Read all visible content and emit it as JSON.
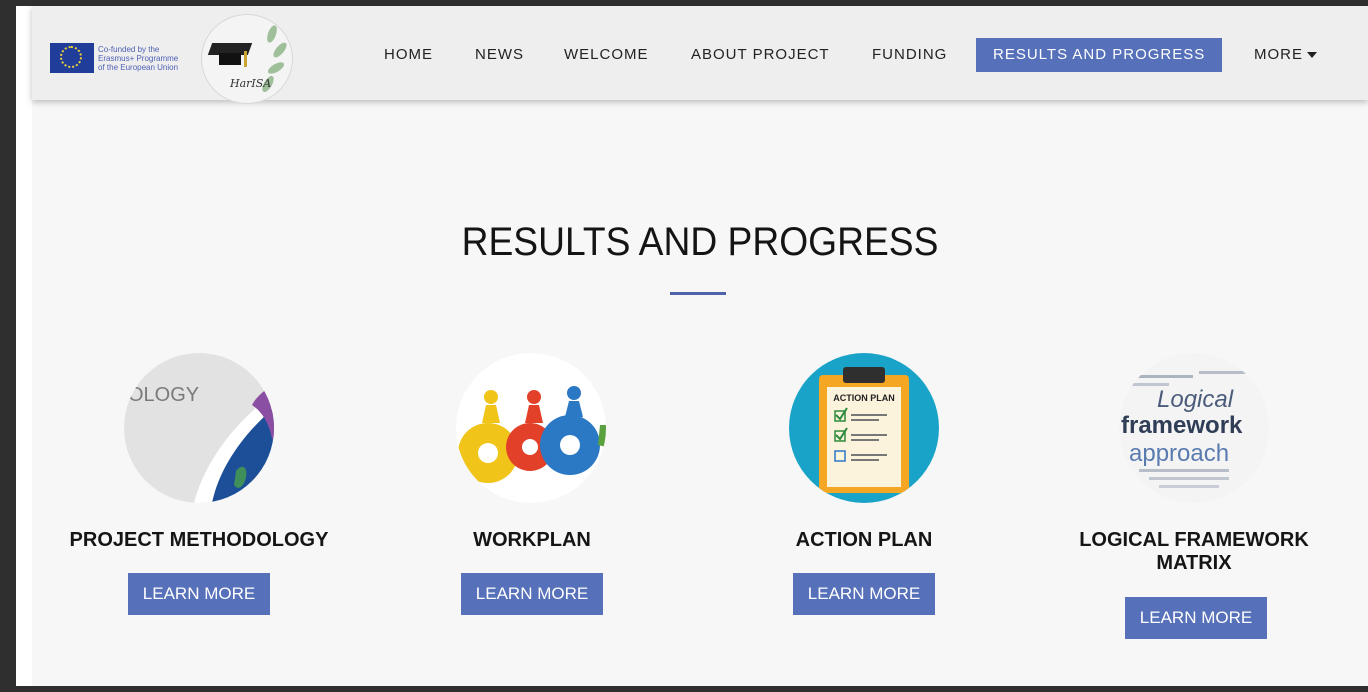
{
  "header": {
    "eu_text": [
      "Co-funded by the",
      "Erasmus+ Programme",
      "of the European Union"
    ],
    "logo_text": "HarISA"
  },
  "nav": {
    "home": "HOME",
    "news": "NEWS",
    "welcome": "WELCOME",
    "about": "ABOUT PROJECT",
    "funding": "FUNDING",
    "results": "RESULTS AND PROGRESS",
    "more": "MORE"
  },
  "main": {
    "title": "RESULTS AND PROGRESS",
    "cards": [
      {
        "title": "PROJECT METHODOLOGY",
        "image_text": "OLOGY",
        "button": "LEARN MORE"
      },
      {
        "title": "WORKPLAN",
        "button": "LEARN MORE"
      },
      {
        "title": "ACTION PLAN",
        "image_text": "ACTION PLAN",
        "button": "LEARN MORE"
      },
      {
        "title_lines": [
          "LOGICAL FRAMEWORK",
          "MATRIX"
        ],
        "image_text": [
          "Logical",
          "framework",
          "approach"
        ],
        "button": "LEARN MORE"
      }
    ]
  },
  "colors": {
    "accent": "#5670b9",
    "divider": "#4e63a9",
    "eu_blue": "#1f3d99"
  },
  "icons": {
    "dropdown": "caret-down-icon"
  }
}
